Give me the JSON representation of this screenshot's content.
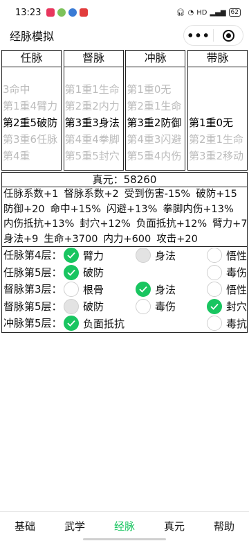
{
  "status": {
    "time": "13:23",
    "network": "HD",
    "battery": "62"
  },
  "header": {
    "title": "经脉模拟"
  },
  "pickers": [
    {
      "name": "任脉",
      "rows": [
        "3命中",
        "第1重4臂力",
        "第2重5破防",
        "第3重6任脉",
        "第4重"
      ],
      "selected": 2
    },
    {
      "name": "督脉",
      "rows": [
        "",
        "第1重1生命",
        "第2重2内力",
        "第3重3身法",
        "第4重4拳脚",
        "第5重5封穴"
      ],
      "selected": 3
    },
    {
      "name": "冲脉",
      "rows": [
        "",
        "第1重0无",
        "第2重1生命",
        "第3重2防御",
        "第4重3闪避",
        "第5重4内伤"
      ],
      "selected": 3
    },
    {
      "name": "带脉",
      "rows": [
        "",
        "",
        "",
        "第1重0无",
        "第2重1生命",
        "第3重2移动"
      ],
      "selected": 3
    }
  ],
  "stats": {
    "zhenyuan": "真元：58260",
    "lines": [
      [
        "任脉系数+1",
        "督脉系数+2",
        "受到伤害-15%",
        "破防+15"
      ],
      [
        "防御+20",
        "命中+15%",
        "闪避+13%",
        "拳脚内伤+13%"
      ],
      [
        "内伤抵抗+13%",
        "封穴+12%",
        "负面抵抗+12%",
        "臂力+7"
      ],
      [
        "身法+9",
        "生命+3700",
        "内力+600",
        "攻击+20"
      ]
    ]
  },
  "options": [
    {
      "label": "任脉第4层：",
      "choices": [
        {
          "text": "臂力",
          "state": "on"
        },
        {
          "text": "身法",
          "state": "disabled"
        },
        {
          "text": "悟性",
          "state": "off"
        }
      ]
    },
    {
      "label": "任脉第5层：",
      "choices": [
        {
          "text": "破防",
          "state": "on"
        },
        {
          "text": "",
          "state": "none"
        },
        {
          "text": "毒伤",
          "state": "off"
        }
      ]
    },
    {
      "label": "督脉第3层：",
      "choices": [
        {
          "text": "根骨",
          "state": "off"
        },
        {
          "text": "身法",
          "state": "on"
        },
        {
          "text": "悟性",
          "state": "off"
        }
      ]
    },
    {
      "label": "督脉第5层：",
      "choices": [
        {
          "text": "破防",
          "state": "disabled"
        },
        {
          "text": "毒伤",
          "state": "off"
        },
        {
          "text": "封穴",
          "state": "on"
        }
      ]
    },
    {
      "label": "冲脉第5层：",
      "choices": [
        {
          "text": "负面抵抗",
          "state": "on"
        },
        {
          "text": "",
          "state": "none"
        },
        {
          "text": "毒抗",
          "state": "off"
        }
      ]
    }
  ],
  "tabs": [
    {
      "label": "基础",
      "active": false
    },
    {
      "label": "武学",
      "active": false
    },
    {
      "label": "经脉",
      "active": true
    },
    {
      "label": "真元",
      "active": false
    },
    {
      "label": "帮助",
      "active": false
    }
  ],
  "colors": {
    "accent": "#19c560",
    "disabled": "#e3e3e3",
    "faded_text": "#bbbbbb"
  }
}
